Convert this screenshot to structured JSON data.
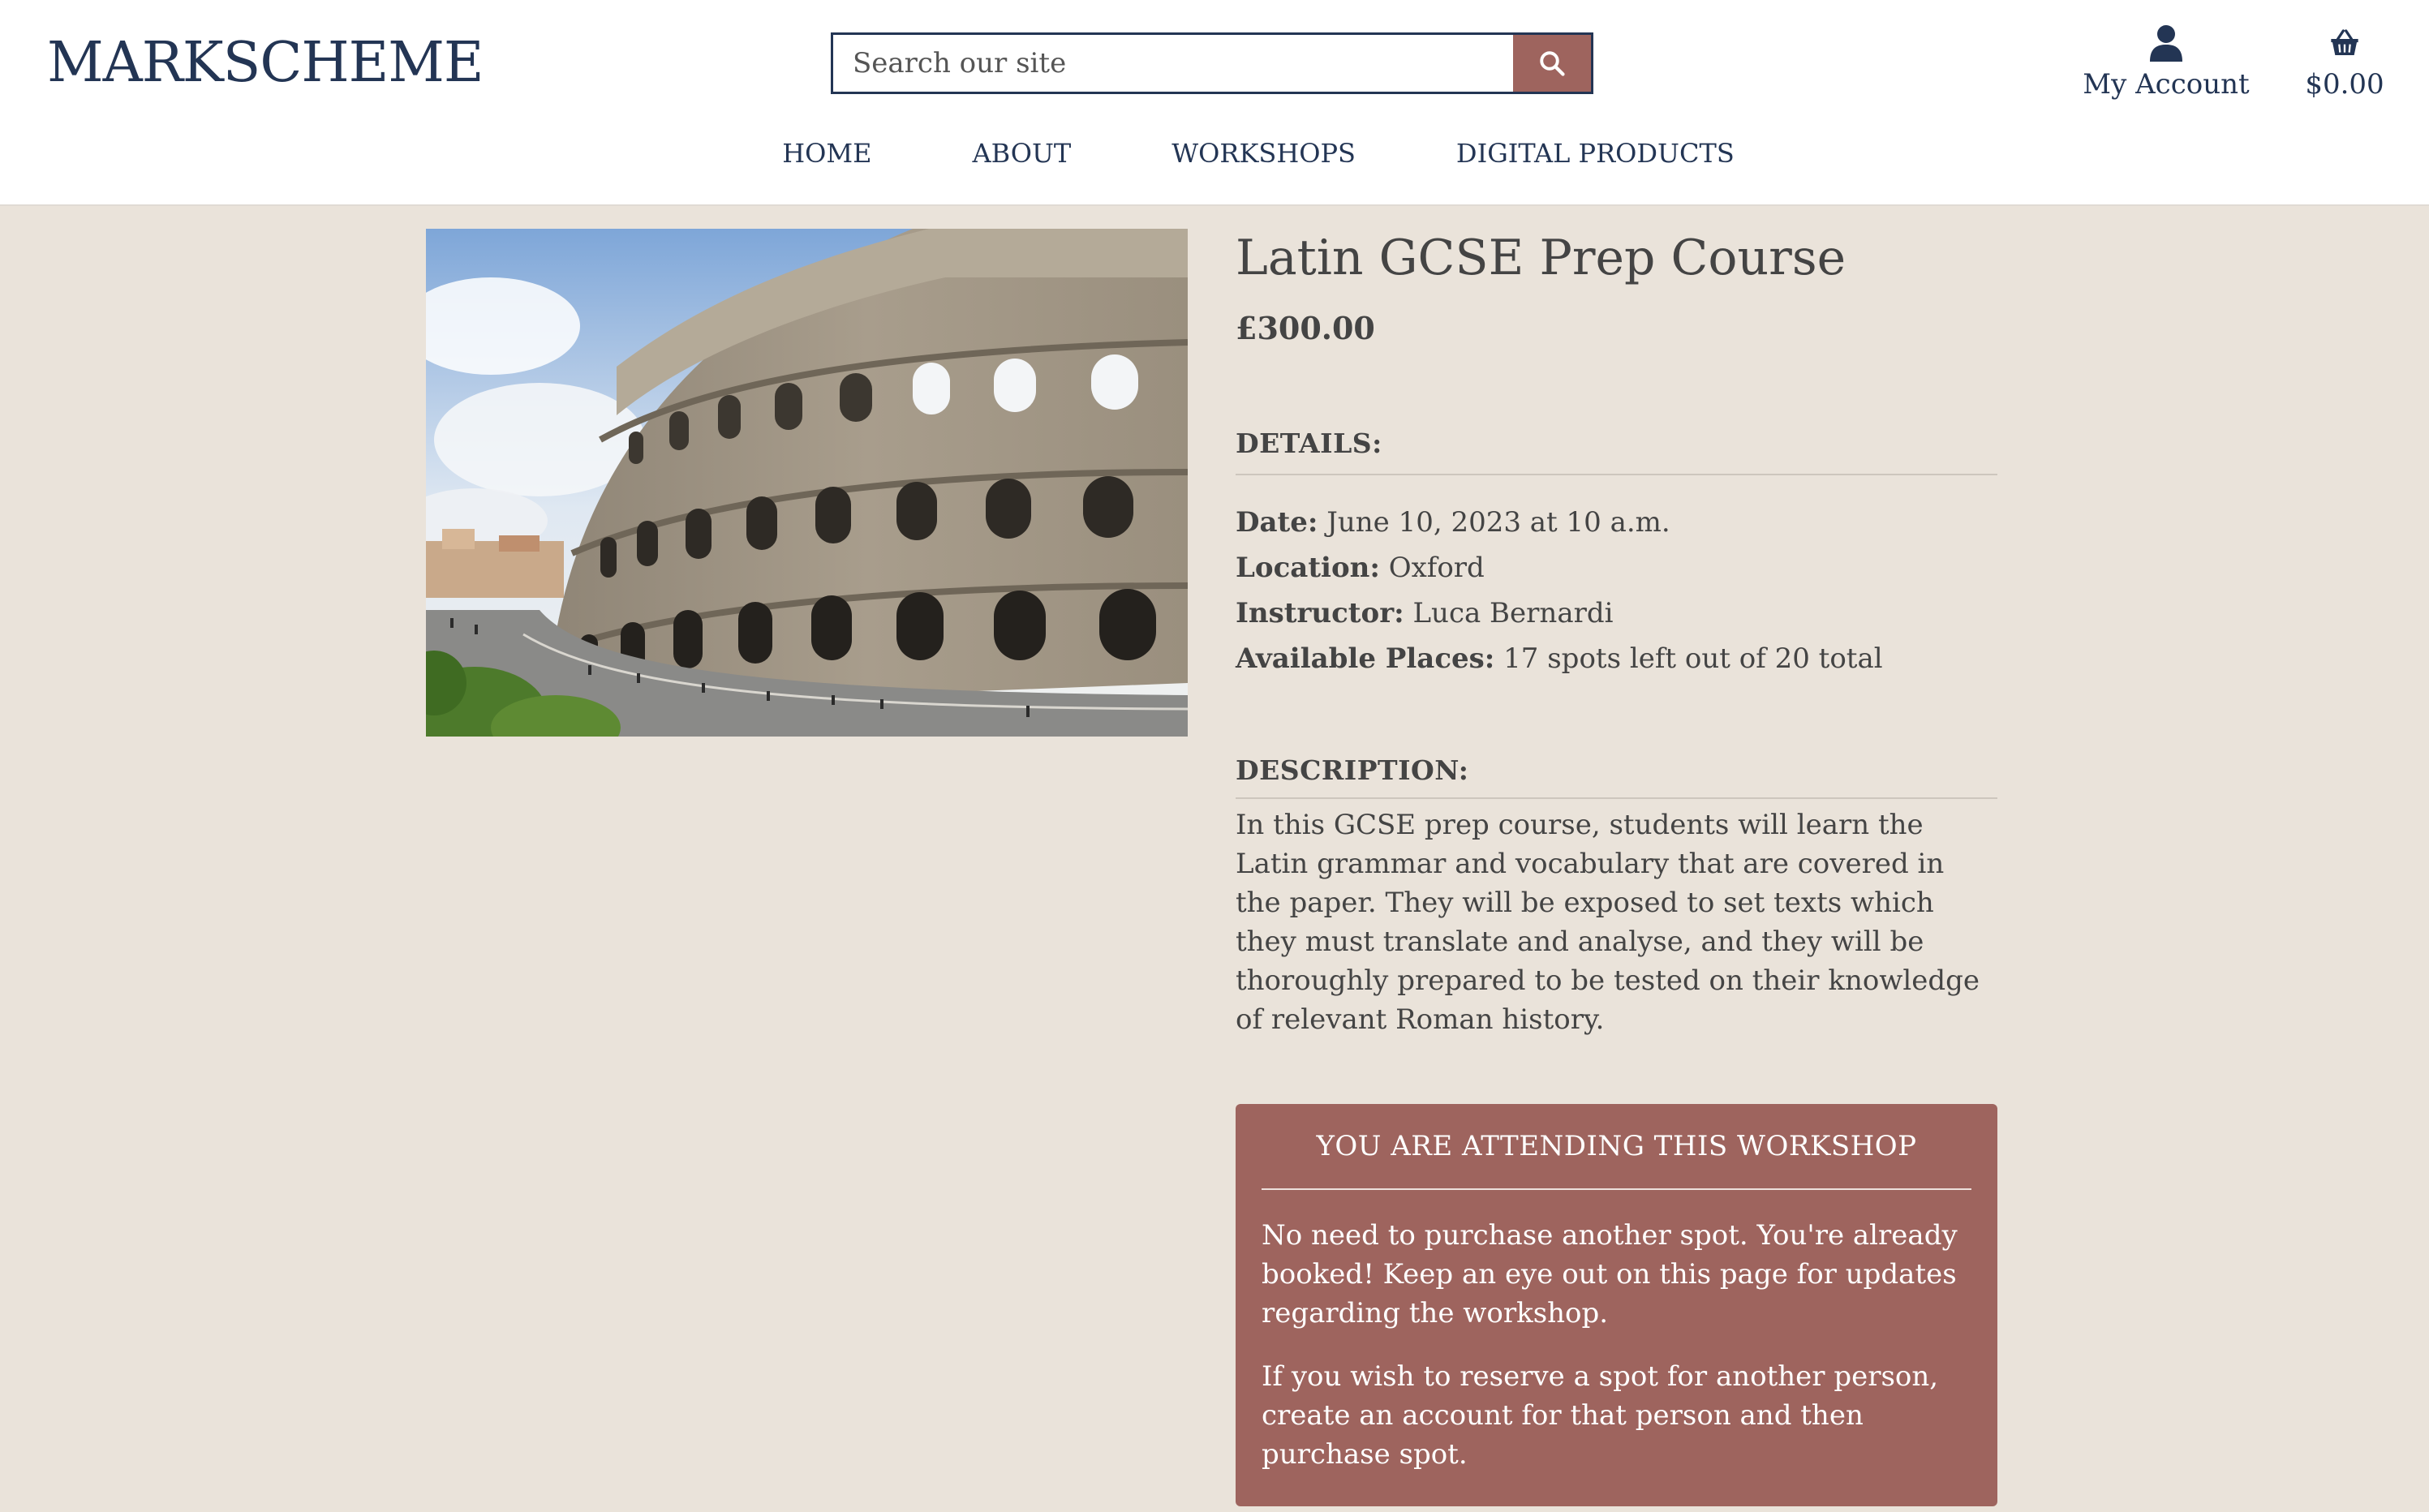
{
  "header": {
    "logo": "MARKSCHEME",
    "search_placeholder": "Search our site",
    "search_icon": "search-icon",
    "account_label": "My Account",
    "account_icon": "user-icon",
    "basket_total": "$0.00",
    "basket_icon": "basket-icon",
    "accent_color": "#9e645e",
    "brand_color": "#233554"
  },
  "nav": {
    "items": [
      "HOME",
      "ABOUT",
      "WORKSHOPS",
      "DIGITAL PRODUCTS"
    ]
  },
  "product": {
    "image_alt": "Colosseum in Rome",
    "title": "Latin GCSE Prep Course",
    "price": "£300.00",
    "details_heading": "DETAILS:",
    "date_label": "Date:",
    "date_value": " June 10, 2023 at 10 a.m.",
    "location_label": "Location:",
    "location_value": " Oxford",
    "instructor_label": "Instructor:",
    "instructor_value": " Luca Bernardi",
    "places_label": "Available Places:",
    "places_value": " 17 spots left out of 20 total",
    "description_heading": "DESCRIPTION:",
    "description": "In this GCSE prep course, students will learn the Latin grammar and vocabulary that are covered in the paper. They will be exposed to set texts which they must translate and analyse, and they will be thoroughly prepared to be tested on their knowledge of relevant Roman history."
  },
  "attending": {
    "title": "YOU ARE ATTENDING THIS WORKSHOP",
    "message_1": "No need to purchase another spot. You're already booked! Keep an eye out on this page for updates regarding the workshop.",
    "message_2": "If you wish to reserve a spot for another person, create an account for that person and then purchase spot."
  }
}
